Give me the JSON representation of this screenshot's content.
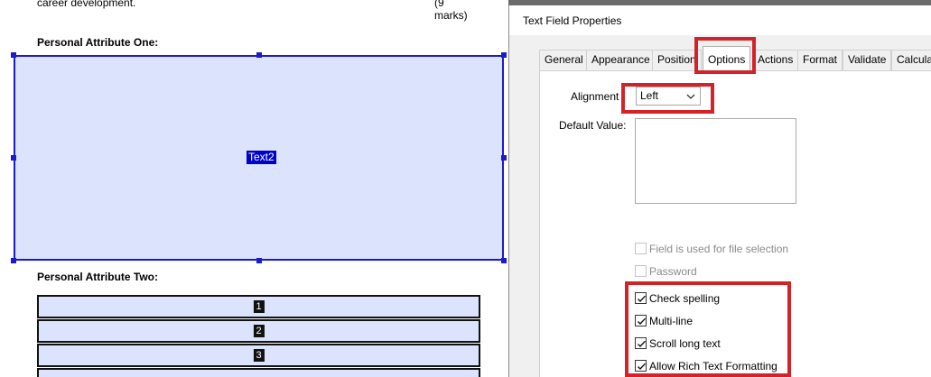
{
  "document": {
    "intro_text": "career development.",
    "intro_marks": "(9 marks)",
    "section_one_label": "Personal Attribute One:",
    "section_one_field": "Text2",
    "section_two_label": "Personal Attribute Two:",
    "rows": [
      "1",
      "2",
      "3"
    ]
  },
  "dialog": {
    "title": "Text Field Properties",
    "tabs": [
      "General",
      "Appearance",
      "Position",
      "Options",
      "Actions",
      "Format",
      "Validate",
      "Calculate"
    ],
    "active_tab": "Options",
    "alignment_label": "Alignment",
    "alignment_value": "Left",
    "default_value_label": "Default Value:",
    "options": {
      "file_selection": "Field is used for file selection",
      "password": "Password",
      "check_spelling": "Check spelling",
      "multi_line": "Multi-line",
      "scroll_long_text": "Scroll long text",
      "rich_text": "Allow Rich Text Formatting"
    }
  },
  "colors": {
    "highlight": "#d2232a",
    "field_fill": "#dbe3fd",
    "field_border": "#1a1ad0"
  }
}
